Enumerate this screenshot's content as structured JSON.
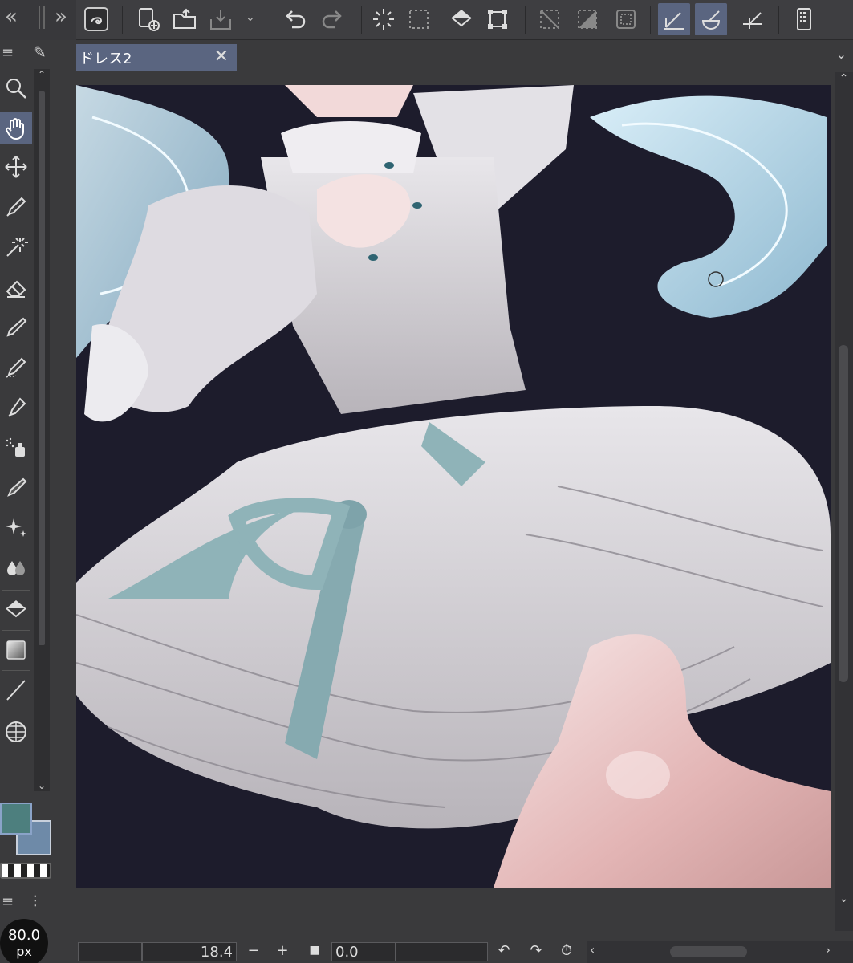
{
  "document": {
    "tab_label": "ドレス2",
    "close_glyph": "✕"
  },
  "toolbar": {
    "collapse_left": "«",
    "panel_toggle": "»"
  },
  "tool_palette": {
    "menu_glyph": "≡"
  },
  "tool_property": {
    "menu_glyph": "≡",
    "brush_size_value": "80.0",
    "brush_size_unit": "px"
  },
  "navigator": {
    "zoom_value": "18.4",
    "zoom_out": "−",
    "zoom_in": "+",
    "rotate_value": "0.0"
  },
  "colors": {
    "main_color": "#4d7f7e",
    "sub_color": "#6e8aa8",
    "canvas_bg": "#1d1c2c",
    "accent": "#5a6580"
  }
}
